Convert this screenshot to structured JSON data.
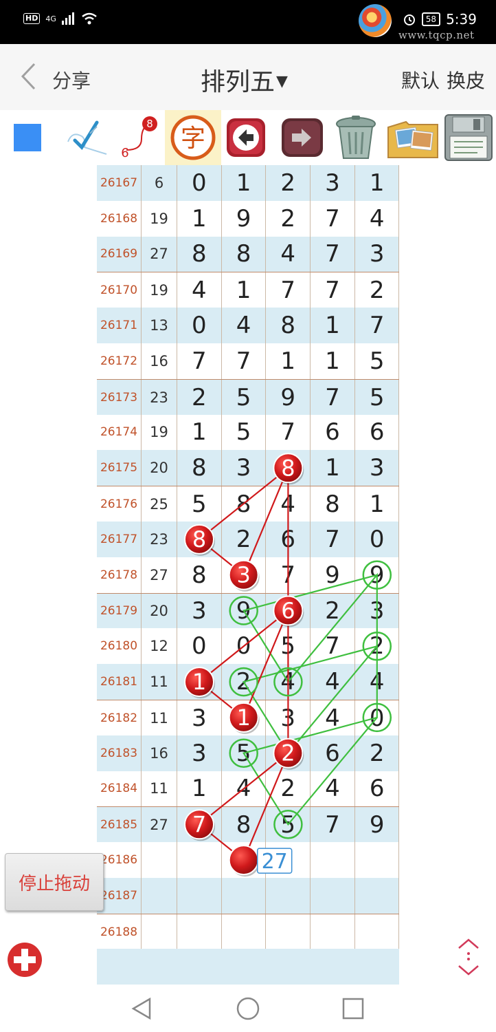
{
  "status_bar": {
    "hd_label": "HD",
    "network_label": "4G",
    "battery_level": "58",
    "time": "5:39"
  },
  "watermark": {
    "site_text": "www.tqcp.net"
  },
  "header": {
    "back_icon": "chevron-left-icon",
    "share_label": "分享",
    "title": "排列五",
    "default_label": "默认",
    "skin_label": "换皮"
  },
  "toolbar": {
    "tools": [
      "blue-square-icon",
      "check-pen-icon",
      "route-6-8-icon",
      "zi-character-icon",
      "arrow-left-icon",
      "arrow-right-icon",
      "trash-can-icon",
      "photos-icon",
      "floppy-disk-icon"
    ],
    "route_from": "6",
    "route_to": "8",
    "char_label": "字"
  },
  "table": {
    "rows": [
      {
        "issue": "26167",
        "sum": "6",
        "digits": [
          "0",
          "1",
          "2",
          "3",
          "1"
        ]
      },
      {
        "issue": "26168",
        "sum": "19",
        "digits": [
          "1",
          "9",
          "2",
          "7",
          "4"
        ]
      },
      {
        "issue": "26169",
        "sum": "27",
        "digits": [
          "8",
          "8",
          "4",
          "7",
          "3"
        ]
      },
      {
        "issue": "26170",
        "sum": "19",
        "digits": [
          "4",
          "1",
          "7",
          "7",
          "2"
        ]
      },
      {
        "issue": "26171",
        "sum": "13",
        "digits": [
          "0",
          "4",
          "8",
          "1",
          "7"
        ]
      },
      {
        "issue": "26172",
        "sum": "16",
        "digits": [
          "7",
          "7",
          "1",
          "1",
          "5"
        ]
      },
      {
        "issue": "26173",
        "sum": "23",
        "digits": [
          "2",
          "5",
          "9",
          "7",
          "5"
        ]
      },
      {
        "issue": "26174",
        "sum": "19",
        "digits": [
          "1",
          "5",
          "7",
          "6",
          "6"
        ]
      },
      {
        "issue": "26175",
        "sum": "20",
        "digits": [
          "8",
          "3",
          "8",
          "1",
          "3"
        ]
      },
      {
        "issue": "26176",
        "sum": "25",
        "digits": [
          "5",
          "8",
          "4",
          "8",
          "1"
        ]
      },
      {
        "issue": "26177",
        "sum": "23",
        "digits": [
          "8",
          "2",
          "6",
          "7",
          "0"
        ]
      },
      {
        "issue": "26178",
        "sum": "27",
        "digits": [
          "8",
          "3",
          "7",
          "9",
          "9"
        ]
      },
      {
        "issue": "26179",
        "sum": "20",
        "digits": [
          "3",
          "9",
          "6",
          "2",
          "3"
        ]
      },
      {
        "issue": "26180",
        "sum": "12",
        "digits": [
          "0",
          "0",
          "5",
          "7",
          "2"
        ]
      },
      {
        "issue": "26181",
        "sum": "11",
        "digits": [
          "1",
          "2",
          "4",
          "4",
          "4"
        ]
      },
      {
        "issue": "26182",
        "sum": "11",
        "digits": [
          "3",
          "1",
          "3",
          "4",
          "0"
        ]
      },
      {
        "issue": "26183",
        "sum": "16",
        "digits": [
          "3",
          "5",
          "2",
          "6",
          "2"
        ]
      },
      {
        "issue": "26184",
        "sum": "11",
        "digits": [
          "1",
          "4",
          "2",
          "4",
          "6"
        ]
      },
      {
        "issue": "26185",
        "sum": "27",
        "digits": [
          "7",
          "8",
          "5",
          "7",
          "9"
        ]
      },
      {
        "issue": "26186",
        "sum": "",
        "digits": [
          "",
          "",
          "",
          "",
          ""
        ]
      },
      {
        "issue": "26187",
        "sum": "",
        "digits": [
          "",
          "",
          "",
          "",
          ""
        ]
      },
      {
        "issue": "26188",
        "sum": "",
        "digits": [
          "",
          "",
          "",
          "",
          ""
        ]
      }
    ]
  },
  "red_path": [
    {
      "row": 8,
      "col": 2
    },
    {
      "row": 10,
      "col": 0
    },
    {
      "row": 11,
      "col": 1
    },
    {
      "row": 8,
      "col": 2
    },
    {
      "row": 12,
      "col": 2
    },
    {
      "row": 14,
      "col": 0
    },
    {
      "row": 15,
      "col": 1
    },
    {
      "row": 12,
      "col": 2
    },
    {
      "row": 16,
      "col": 2
    },
    {
      "row": 18,
      "col": 0
    },
    {
      "row": 19,
      "col": 1
    },
    {
      "row": 16,
      "col": 2
    }
  ],
  "red_marks": [
    {
      "row": 8,
      "col": 2,
      "label": "8"
    },
    {
      "row": 10,
      "col": 0,
      "label": "8"
    },
    {
      "row": 11,
      "col": 1,
      "label": "3"
    },
    {
      "row": 12,
      "col": 2,
      "label": "6"
    },
    {
      "row": 14,
      "col": 0,
      "label": "1"
    },
    {
      "row": 15,
      "col": 1,
      "label": "1"
    },
    {
      "row": 16,
      "col": 2,
      "label": "2"
    },
    {
      "row": 18,
      "col": 0,
      "label": "7"
    },
    {
      "row": 19,
      "col": 1,
      "label": ""
    }
  ],
  "green_path": [
    {
      "row": 11,
      "col": 4
    },
    {
      "row": 12,
      "col": 1
    },
    {
      "row": 14,
      "col": 2
    },
    {
      "row": 11,
      "col": 4
    },
    {
      "row": 13,
      "col": 4
    },
    {
      "row": 14,
      "col": 1
    },
    {
      "row": 16,
      "col": 2
    },
    {
      "row": 13,
      "col": 4
    },
    {
      "row": 15,
      "col": 4
    },
    {
      "row": 16,
      "col": 1
    },
    {
      "row": 18,
      "col": 2
    },
    {
      "row": 15,
      "col": 4
    }
  ],
  "green_marks": [
    {
      "row": 11,
      "col": 4
    },
    {
      "row": 12,
      "col": 1
    },
    {
      "row": 14,
      "col": 2
    },
    {
      "row": 13,
      "col": 4
    },
    {
      "row": 14,
      "col": 1
    },
    {
      "row": 16,
      "col": 2
    },
    {
      "row": 15,
      "col": 4
    },
    {
      "row": 16,
      "col": 1
    },
    {
      "row": 18,
      "col": 2
    }
  ],
  "prediction_box": {
    "row": 19,
    "col": 1,
    "text": "27"
  },
  "controls": {
    "stop_drag_label": "停止拖动",
    "plus_icon": "plus-circle-icon",
    "scroll_icon": "up-down-arrows-icon"
  },
  "nav_bar": {
    "back": "triangle-back-icon",
    "home": "circle-home-icon",
    "recent": "square-recent-icon"
  },
  "colors": {
    "red": "#d0191b",
    "green": "#3fbf3f",
    "row_tint": "#d9ecf4",
    "issue_text": "#c0522a",
    "box_blue": "#3a8fd4"
  }
}
